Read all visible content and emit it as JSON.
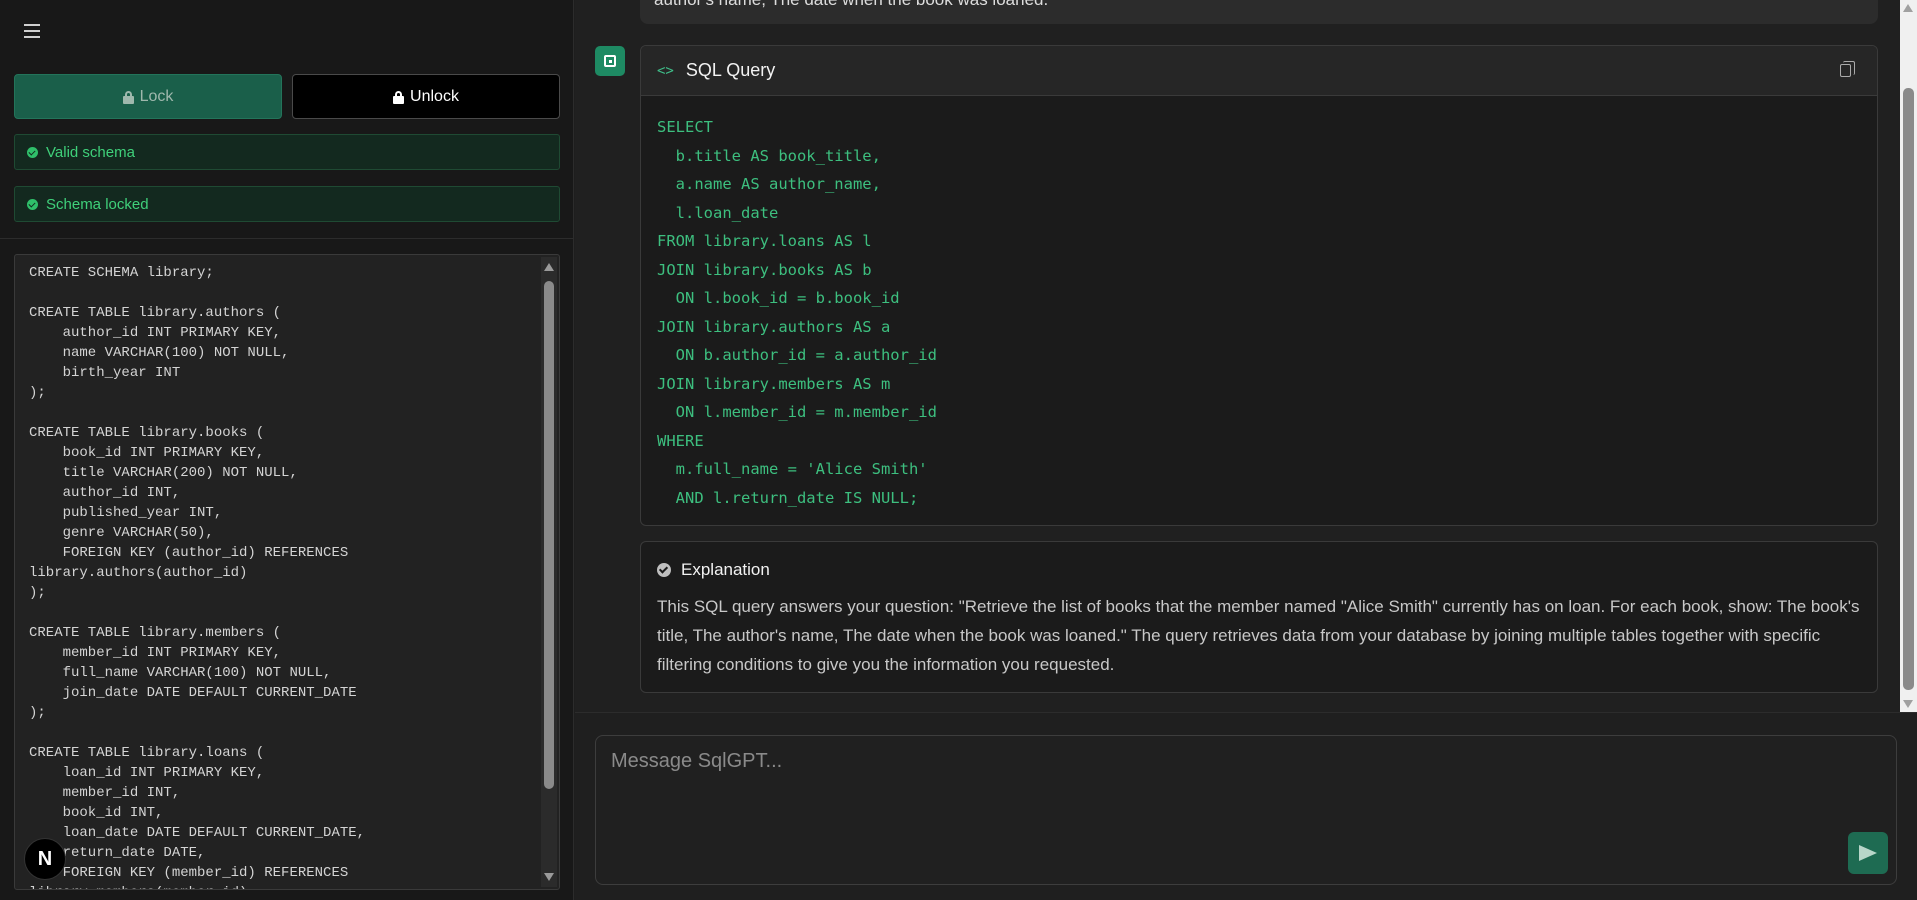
{
  "sidebar": {
    "lock_label": "Lock",
    "unlock_label": "Unlock",
    "statuses": [
      "Valid schema",
      "Schema locked"
    ],
    "schema_sql": "CREATE SCHEMA library;\n\nCREATE TABLE library.authors (\n    author_id INT PRIMARY KEY,\n    name VARCHAR(100) NOT NULL,\n    birth_year INT\n);\n\nCREATE TABLE library.books (\n    book_id INT PRIMARY KEY,\n    title VARCHAR(200) NOT NULL,\n    author_id INT,\n    published_year INT,\n    genre VARCHAR(50),\n    FOREIGN KEY (author_id) REFERENCES\nlibrary.authors(author_id)\n);\n\nCREATE TABLE library.members (\n    member_id INT PRIMARY KEY,\n    full_name VARCHAR(100) NOT NULL,\n    join_date DATE DEFAULT CURRENT_DATE\n);\n\nCREATE TABLE library.loans (\n    loan_id INT PRIMARY KEY,\n    member_id INT,\n    book_id INT,\n    loan_date DATE DEFAULT CURRENT_DATE,\n    return_date DATE,\n    FOREIGN KEY (member_id) REFERENCES\nlibrary.members(member_id),",
    "badge_letter": "N"
  },
  "chat": {
    "prev_message_tail": "author's name, The date when the book was loaned.",
    "sql_card": {
      "title": "SQL Query",
      "code_icon": "<>",
      "code": "SELECT\n  b.title AS book_title,\n  a.name AS author_name,\n  l.loan_date\nFROM library.loans AS l\nJOIN library.books AS b\n  ON l.book_id = b.book_id\nJOIN library.authors AS a\n  ON b.author_id = a.author_id\nJOIN library.members AS m\n  ON l.member_id = m.member_id\nWHERE\n  m.full_name = 'Alice Smith'\n  AND l.return_date IS NULL;"
    },
    "explanation": {
      "title": "Explanation",
      "text": "This SQL query answers your question: \"Retrieve the list of books that the member named \"Alice Smith\" currently has on loan. For each book, show: The book's title, The author's name, The date when the book was loaned.\" The query retrieves data from your database by joining multiple tables together with specific filtering conditions to give you the information you requested."
    }
  },
  "composer": {
    "placeholder": "Message SqlGPT...",
    "value": ""
  },
  "colors": {
    "accent": "#1e8a63",
    "code_green": "#3dbf7f",
    "status_green": "#3fd07a"
  }
}
